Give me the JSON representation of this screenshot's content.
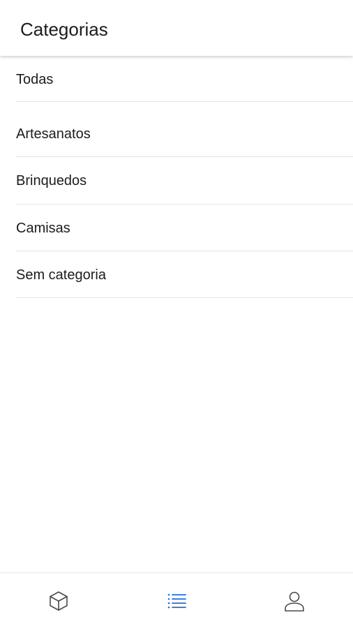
{
  "header": {
    "title": "Categorias"
  },
  "categories": {
    "items": [
      {
        "label": "Todas"
      },
      {
        "label": "Artesanatos"
      },
      {
        "label": "Brinquedos"
      },
      {
        "label": "Camisas"
      },
      {
        "label": "Sem categoria"
      }
    ]
  },
  "tabbar": {
    "tabs": [
      {
        "icon": "box-icon",
        "active": false
      },
      {
        "icon": "list-icon",
        "active": true
      },
      {
        "icon": "user-icon",
        "active": false
      }
    ],
    "active_color": "#1e6fd9",
    "inactive_color": "#4a4a4a"
  }
}
